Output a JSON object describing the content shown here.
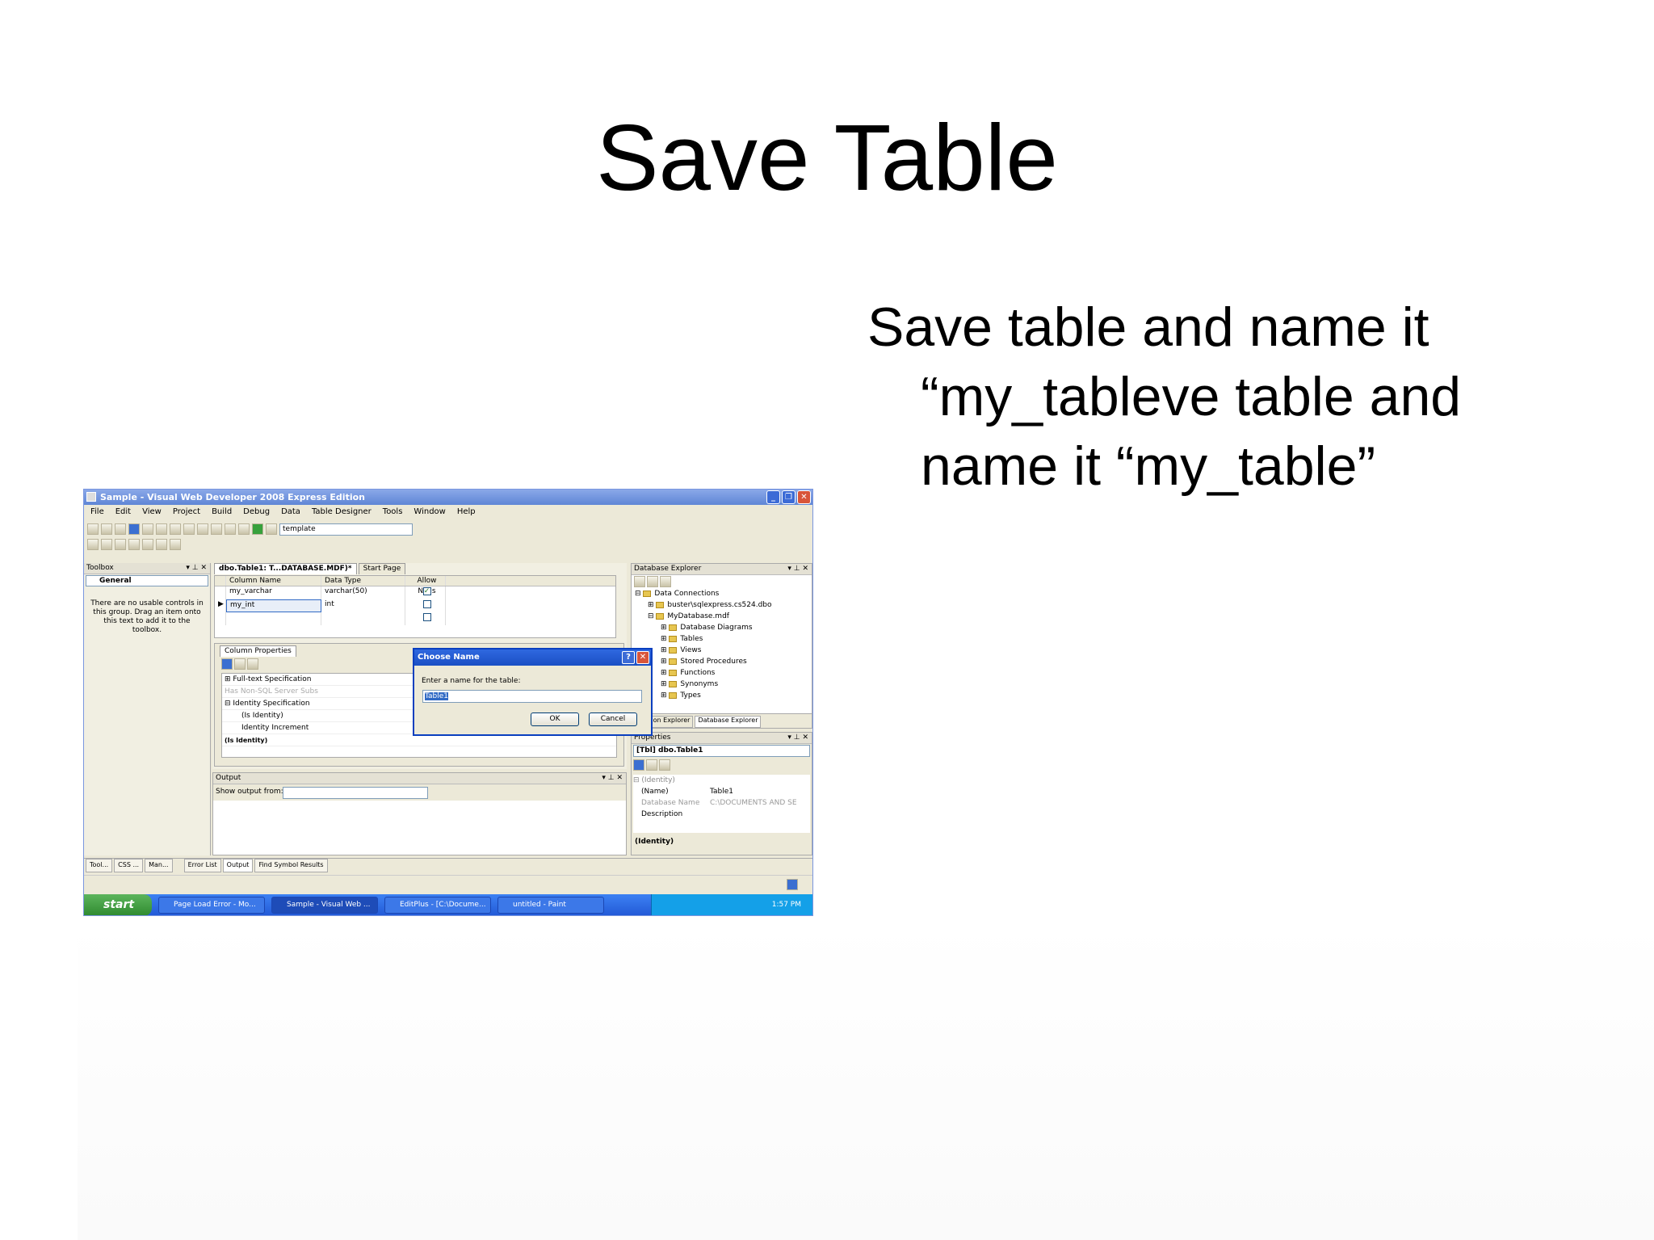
{
  "slide": {
    "title": "Save Table",
    "bullet_line1": "Save table and name it",
    "bullet_line2": "“my_tableve table and",
    "bullet_line3": "name it “my_table”"
  },
  "window": {
    "title": "Sample - Visual Web Developer 2008 Express Edition",
    "menu": [
      "File",
      "Edit",
      "View",
      "Project",
      "Build",
      "Debug",
      "Data",
      "Table Designer",
      "Tools",
      "Window",
      "Help"
    ],
    "toolbar_combo": "template"
  },
  "toolbox": {
    "header": "Toolbox",
    "group": "General",
    "message": "There are no usable controls in this group. Drag an item onto this text to add it to the toolbox."
  },
  "editor": {
    "tabs": [
      "dbo.Table1: T...DATABASE.MDF)*",
      "Start Page"
    ],
    "columns": [
      "Column Name",
      "Data Type",
      "Allow Nulls"
    ],
    "rows": [
      {
        "name": "my_varchar",
        "type": "varchar(50)",
        "null": "✓"
      },
      {
        "name": "my_int",
        "type": "int",
        "null": ""
      }
    ],
    "column_properties_tab": "Column Properties",
    "properties": [
      "Full-text Specification",
      "Has Non-SQL Server Subs",
      "Identity Specification",
      "(Is Identity)",
      "Identity Increment",
      "(Is Identity)"
    ]
  },
  "dialog": {
    "title": "Choose Name",
    "prompt": "Enter a name for the table:",
    "value": "Table1",
    "ok": "OK",
    "cancel": "Cancel"
  },
  "output": {
    "header": "Output",
    "show_label": "Show output from:"
  },
  "db_explorer": {
    "header": "Database Explorer",
    "tree": [
      "Data Connections",
      "buster\\sqlexpress.cs524.dbo",
      "MyDatabase.mdf",
      "Database Diagrams",
      "Tables",
      "Views",
      "Stored Procedures",
      "Functions",
      "Synonyms",
      "Types"
    ],
    "tabs": [
      "Solution Explorer",
      "Database Explorer"
    ]
  },
  "properties": {
    "header": "Properties",
    "object": "[Tbl] dbo.Table1",
    "category": "(Identity)",
    "rows": [
      {
        "key": "(Name)",
        "value": "Table1"
      },
      {
        "key": "Database Name",
        "value": "C:\\DOCUMENTS AND SE"
      },
      {
        "key": "Description",
        "value": ""
      }
    ],
    "desc": "(Identity)"
  },
  "bottom_tabs": [
    "Tool...",
    "CSS ...",
    "Man...",
    "Error List",
    "Output",
    "Find Symbol Results"
  ],
  "taskbar": {
    "start": "start",
    "tasks": [
      "Page Load Error - Mo...",
      "Sample - Visual Web ...",
      "EditPlus - [C:\\Docume...",
      "untitled - Paint"
    ],
    "clock": "1:57 PM"
  }
}
